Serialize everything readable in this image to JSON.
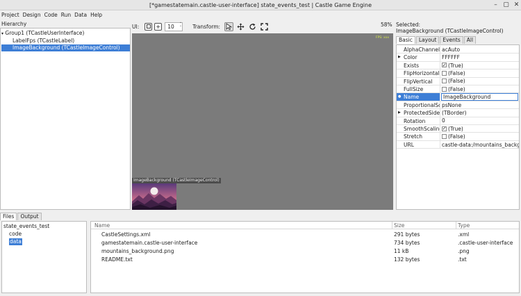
{
  "window": {
    "title": "[*gamestatemain.castle-user-interface] state_events_test | Castle Game Engine"
  },
  "menu": [
    "Project",
    "Design",
    "Code",
    "Run",
    "Data",
    "Help"
  ],
  "hierarchy": {
    "title": "Hierarchy",
    "items": [
      {
        "label": "Group1 (TCastleUserInterface)",
        "expanded": true
      },
      {
        "label": "LabelFps (TCastleLabel)"
      },
      {
        "label": "ImageBackground (TCastleImageControl)",
        "selected": true
      }
    ]
  },
  "toolbar": {
    "ui_label": "UI:",
    "spin_value": "10",
    "transform_label": "Transform:"
  },
  "viewport": {
    "zoom": "58%",
    "fps_text": "FPS: xxx",
    "image_label": "ImageBackground (TCastleImageControl)"
  },
  "inspector": {
    "selected_label": "Selected:",
    "selected_name": "ImageBackground (TCastleImageControl)",
    "tabs": [
      "Basic",
      "Layout",
      "Events",
      "All"
    ],
    "active_tab": "Basic",
    "properties": [
      {
        "name": "AlphaChannel",
        "value": "acAuto"
      },
      {
        "name": "Color",
        "value": "FFFFFF",
        "expandable": true
      },
      {
        "name": "Exists",
        "value": "(True)",
        "checkbox": true,
        "checked": true
      },
      {
        "name": "FlipHorizontal",
        "value": "(False)",
        "checkbox": true,
        "checked": false
      },
      {
        "name": "FlipVertical",
        "value": "(False)",
        "checkbox": true,
        "checked": false
      },
      {
        "name": "FullSize",
        "value": "(False)",
        "checkbox": true,
        "checked": false
      },
      {
        "name": "Name",
        "value": "ImageBackground",
        "selected": true
      },
      {
        "name": "ProportionalScaling",
        "value": "psNone"
      },
      {
        "name": "ProtectedSides",
        "value": "(TBorder)",
        "expandable": true
      },
      {
        "name": "Rotation",
        "value": "0"
      },
      {
        "name": "SmoothScaling",
        "value": "(True)",
        "checkbox": true,
        "checked": true
      },
      {
        "name": "Stretch",
        "value": "(False)",
        "checkbox": true,
        "checked": false
      },
      {
        "name": "URL",
        "value": "castle-data:/mountains_background.png"
      }
    ]
  },
  "bottom": {
    "tabs": [
      "Files",
      "Output"
    ],
    "active_tab": "Files",
    "tree": [
      {
        "label": "state_events_test"
      },
      {
        "label": "code"
      },
      {
        "label": "data",
        "selected": true
      }
    ],
    "columns": [
      "Name",
      "Size",
      "Type"
    ],
    "files": [
      {
        "name": "CastleSettings.xml",
        "size": "291 bytes",
        "type": ".xml"
      },
      {
        "name": "gamestatemain.castle-user-interface",
        "size": "734 bytes",
        "type": ".castle-user-interface"
      },
      {
        "name": "mountains_background.png",
        "size": "11 kB",
        "type": ".png"
      },
      {
        "name": "README.txt",
        "size": "132 bytes",
        "type": ".txt"
      }
    ]
  },
  "colors": {
    "selection": "#3d7ed6",
    "viewport_bg": "#7b7b7b"
  }
}
